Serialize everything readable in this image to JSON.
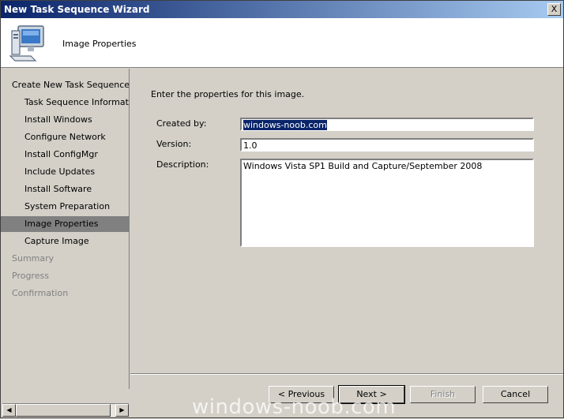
{
  "window": {
    "title": "New Task Sequence Wizard",
    "close_label": "X"
  },
  "header": {
    "title": "Image Properties",
    "icon": "computer-icon"
  },
  "sidebar": {
    "items": [
      {
        "label": "Create New Task Sequence",
        "level": "top",
        "state": "normal"
      },
      {
        "label": "Task Sequence Information",
        "level": "sub",
        "state": "normal"
      },
      {
        "label": "Install Windows",
        "level": "sub",
        "state": "normal"
      },
      {
        "label": "Configure Network",
        "level": "sub",
        "state": "normal"
      },
      {
        "label": "Install ConfigMgr",
        "level": "sub",
        "state": "normal"
      },
      {
        "label": "Include Updates",
        "level": "sub",
        "state": "normal"
      },
      {
        "label": "Install Software",
        "level": "sub",
        "state": "normal"
      },
      {
        "label": "System Preparation",
        "level": "sub",
        "state": "normal"
      },
      {
        "label": "Image Properties",
        "level": "sub",
        "state": "selected"
      },
      {
        "label": "Capture Image",
        "level": "sub",
        "state": "normal"
      },
      {
        "label": "Summary",
        "level": "top",
        "state": "disabled"
      },
      {
        "label": "Progress",
        "level": "top",
        "state": "disabled"
      },
      {
        "label": "Confirmation",
        "level": "top",
        "state": "disabled"
      }
    ]
  },
  "form": {
    "intro": "Enter the properties for this image.",
    "created_by_label": "Created by:",
    "created_by_value": "windows-noob.com",
    "version_label": "Version:",
    "version_value": "1.0",
    "description_label": "Description:",
    "description_value": "Windows Vista SP1 Build and Capture/September 2008"
  },
  "buttons": {
    "previous": "< Previous",
    "next": "Next >",
    "finish": "Finish",
    "cancel": "Cancel"
  },
  "watermark": "windows-noob.com"
}
